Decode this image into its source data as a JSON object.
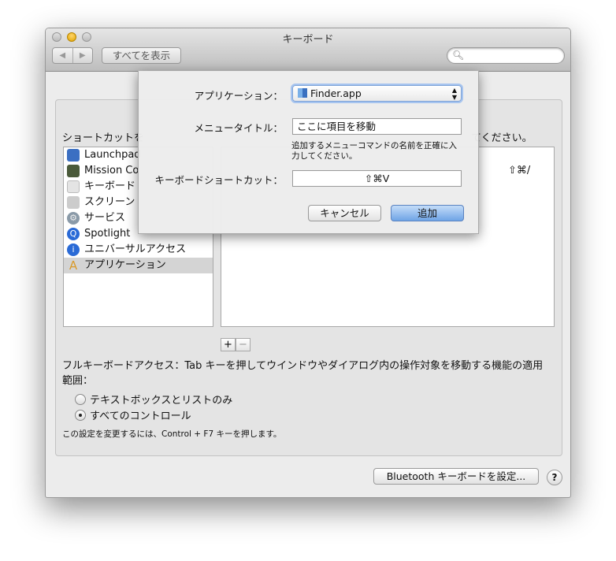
{
  "window": {
    "title": "キーボード",
    "nav_back": "◀",
    "nav_forward": "▶",
    "show_all": "すべてを表示",
    "search_placeholder": ""
  },
  "panel": {
    "instructions_left": "ショートカットを",
    "instructions_right": "てください。",
    "sidebar_items": [
      {
        "label": "Launchpad",
        "icon": "launchpad-icon",
        "color": "#3b6fc2"
      },
      {
        "label": "Mission Co",
        "icon": "mission-control-icon",
        "color": "#4a5a3a"
      },
      {
        "label": "キーボード",
        "icon": "keyboard-icon",
        "color": "#cfcfcf"
      },
      {
        "label": "スクリーン",
        "icon": "screenshot-icon",
        "color": "#bbbbbb"
      },
      {
        "label": "サービス",
        "icon": "gear-icon",
        "color": "#8a9aa8"
      },
      {
        "label": "Spotlight",
        "icon": "spotlight-icon",
        "color": "#2a6ad6"
      },
      {
        "label": "ユニバーサルアクセス",
        "icon": "accessibility-icon",
        "color": "#2a6ad6"
      },
      {
        "label": "アプリケーション",
        "icon": "app-store-icon",
        "color": "#d99a2a"
      }
    ],
    "selected_index": 7,
    "detail_shortcut": "⇧⌘/",
    "add_label": "+",
    "remove_label": "−",
    "full_keyboard_access": "フルキーボードアクセス：Tab キーを押してウインドウやダイアログ内の操作対象を移動する機能の適用範囲：",
    "radio_options": [
      "テキストボックスとリストのみ",
      "すべてのコントロール"
    ],
    "radio_selected": 1,
    "hint": "この設定を変更するには、Control + F7 キーを押します。",
    "bluetooth_button": "Bluetooth キーボードを設定...",
    "help": "?"
  },
  "sheet": {
    "application_label": "アプリケーション：",
    "application_value": "Finder.app",
    "menu_title_label": "メニュータイトル：",
    "menu_title_value": "ここに項目を移動",
    "menu_title_help": "追加するメニューコマンドの名前を正確に入力してください。",
    "shortcut_label": "キーボードショートカット：",
    "shortcut_value": "⇧⌘V",
    "cancel": "キャンセル",
    "add": "追加"
  }
}
